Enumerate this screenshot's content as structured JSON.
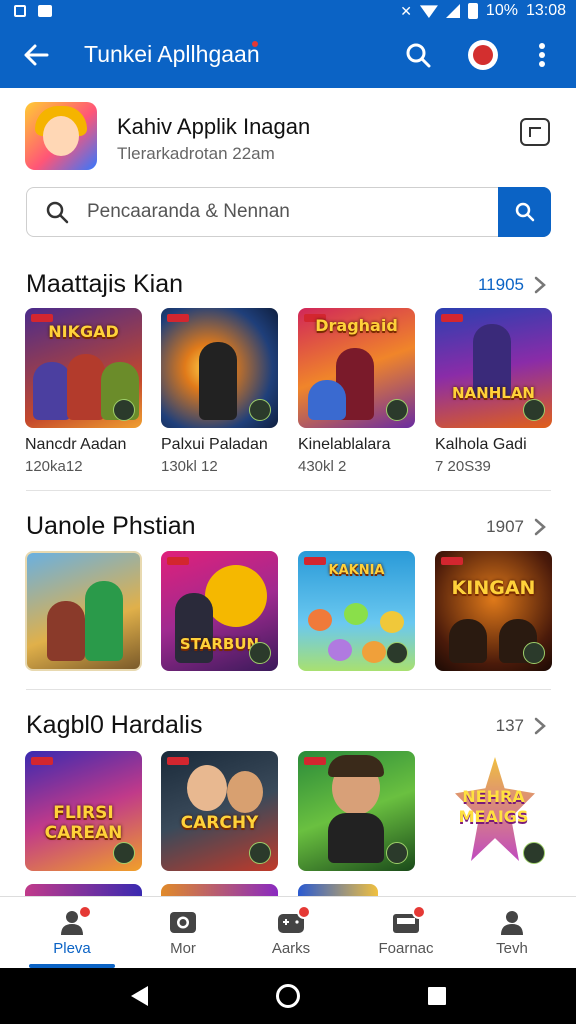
{
  "status_bar": {
    "battery": "10%",
    "time": "13:08"
  },
  "app_bar": {
    "title": "Tunkei Apllhgaan"
  },
  "profile": {
    "name": "Kahiv Applik Inagan",
    "subtitle": "Tlerarkadrotan 22am"
  },
  "search": {
    "placeholder": "Pencaaranda & Nennan"
  },
  "sections": [
    {
      "title": "Maattajis Kian",
      "count": "11905",
      "games": [
        {
          "logo": "NIKGAD",
          "name": "Nancdr Aadan",
          "meta": "120ka12"
        },
        {
          "logo": "",
          "name": "Palxui Paladan",
          "meta": "130kl 12"
        },
        {
          "logo": "Draghaid",
          "name": "Kinelablalara",
          "meta": "430kl 2"
        },
        {
          "logo": "NANHLAN",
          "name": "Kalhola Gadi",
          "meta": "7 20S39"
        }
      ]
    },
    {
      "title": "Uanole Phstian",
      "count": "1907",
      "games": [
        {
          "logo": ""
        },
        {
          "logo": "STARBUN"
        },
        {
          "logo": "KAKNIA"
        },
        {
          "logo": "KINGAN"
        }
      ]
    },
    {
      "title": "Kagbl0 Hardalis",
      "count": "137",
      "games": [
        {
          "logo": "FLIRSI CAREAN"
        },
        {
          "logo": "CARCHY"
        },
        {
          "logo": ""
        },
        {
          "logo": "NEHRA MEAIGS"
        }
      ]
    }
  ],
  "bottom_nav": [
    {
      "label": "Pleva",
      "icon": "person-icon",
      "badge": true,
      "active": true
    },
    {
      "label": "Mor",
      "icon": "camera-icon",
      "badge": false,
      "active": false
    },
    {
      "label": "Aarks",
      "icon": "controller-icon",
      "badge": true,
      "active": false
    },
    {
      "label": "Foarnac",
      "icon": "inbox-icon",
      "badge": true,
      "active": false
    },
    {
      "label": "Tevh",
      "icon": "profile-icon",
      "badge": false,
      "active": false
    }
  ],
  "colors": {
    "primary": "#0b63c5",
    "badge": "#e53935"
  }
}
